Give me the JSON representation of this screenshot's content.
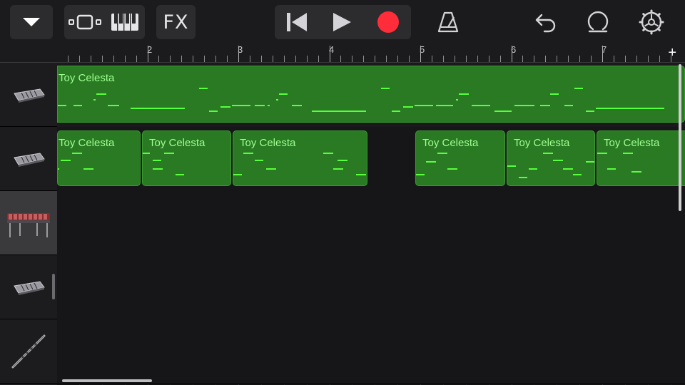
{
  "toolbar": {
    "fx_label": "FX",
    "icons": [
      "chevron-down-icon",
      "tracks-view-icon",
      "keyboard-icon",
      "rewind-icon",
      "play-icon",
      "record-icon",
      "metronome-icon",
      "undo-icon",
      "loop-icon",
      "settings-icon"
    ],
    "record_color": "#ff2d3a"
  },
  "ruler": {
    "bars": [
      "2",
      "3",
      "4",
      "5",
      "6",
      "7"
    ],
    "add_label": "+"
  },
  "tracks": [
    {
      "name": "track-1",
      "icon": "keyboard-instrument-icon",
      "selected": false
    },
    {
      "name": "track-2",
      "icon": "keyboard-instrument-icon",
      "selected": false
    },
    {
      "name": "track-3",
      "icon": "marimba-icon",
      "selected": true
    },
    {
      "name": "track-4",
      "icon": "keyboard-instrument-icon",
      "selected": false
    },
    {
      "name": "track-5",
      "icon": "flute-icon",
      "selected": false
    }
  ],
  "regions": [
    {
      "lane": 0,
      "title": "Toy Celesta"
    },
    {
      "lane": 1,
      "title": "Toy Celesta"
    },
    {
      "lane": 1,
      "title": "Toy Celesta"
    },
    {
      "lane": 1,
      "title": "Toy Celesta"
    },
    {
      "lane": 1,
      "title": "Toy Celesta"
    },
    {
      "lane": 1,
      "title": "Toy Celesta"
    },
    {
      "lane": 1,
      "title": "Toy Celesta"
    }
  ],
  "colors": {
    "region_fill": "#2a7a24",
    "note": "#57ff3c",
    "region_text": "#9dff8e"
  }
}
